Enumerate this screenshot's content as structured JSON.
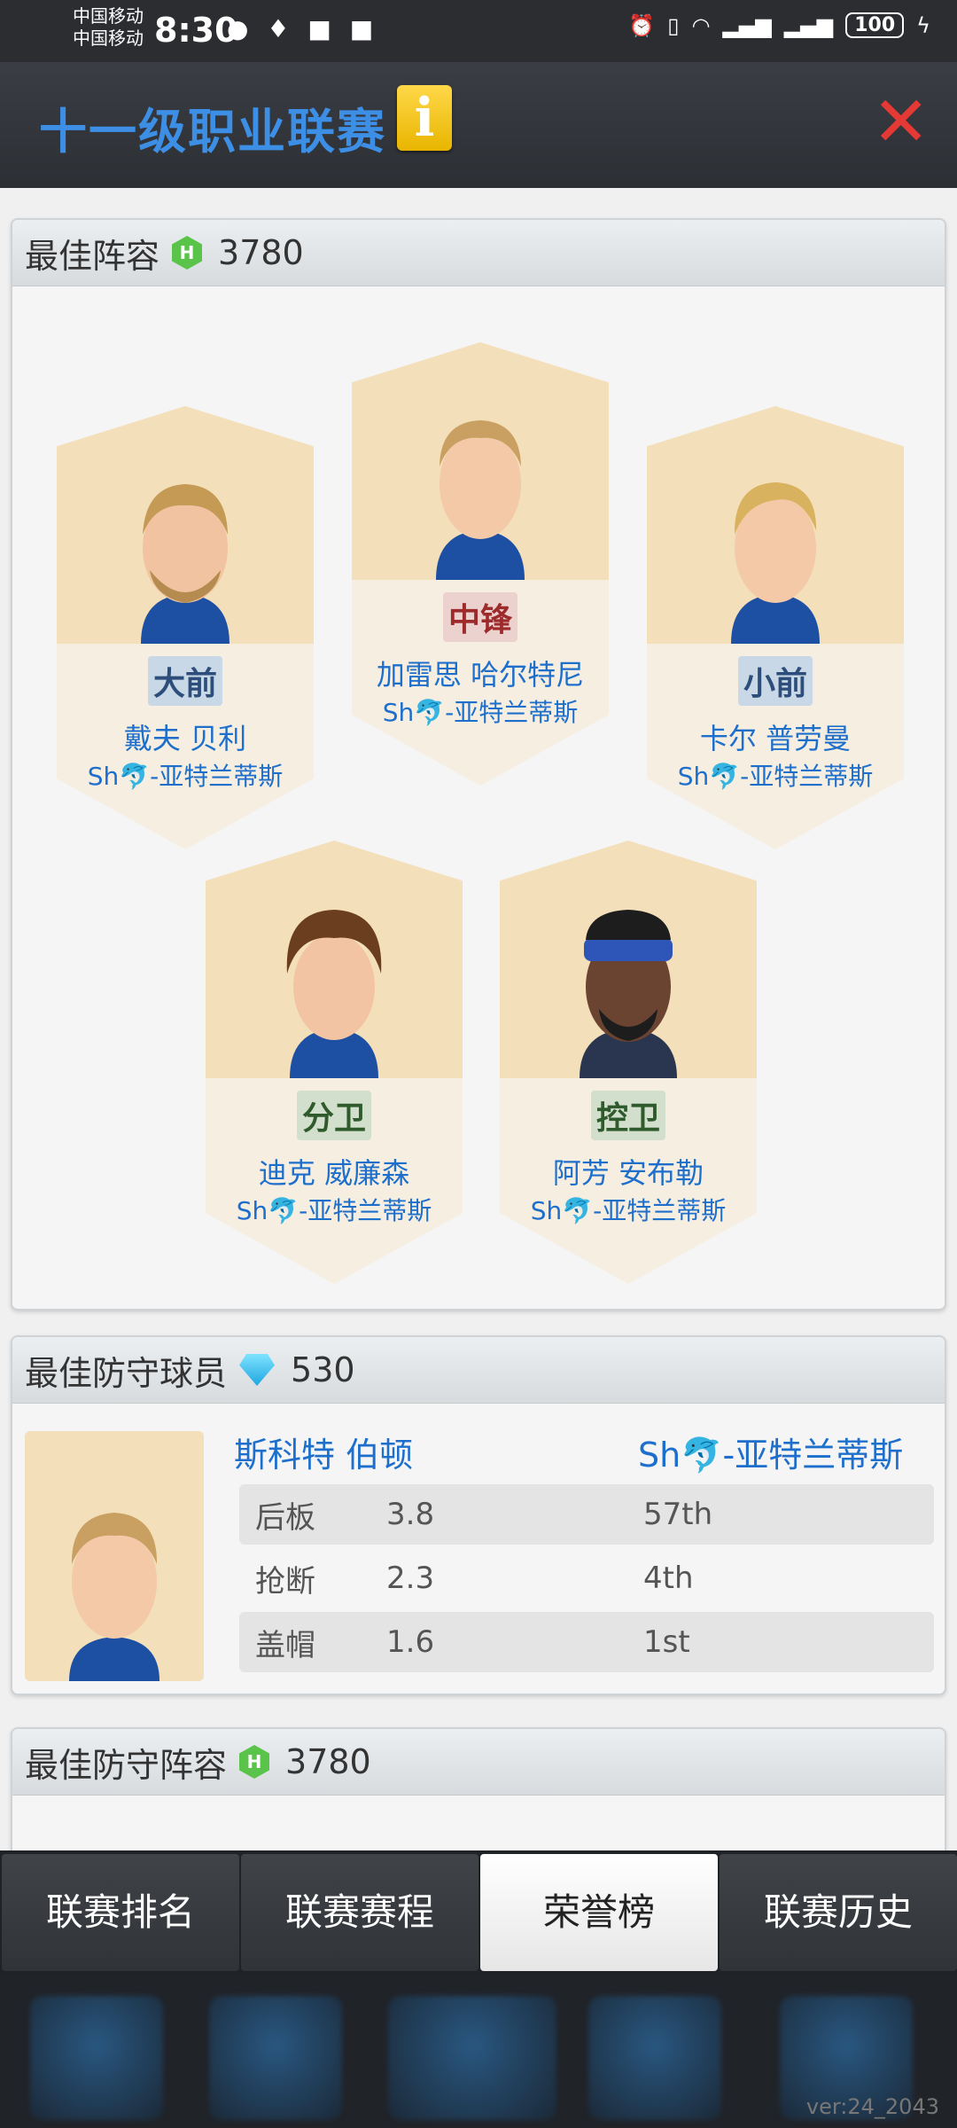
{
  "status_bar": {
    "carrier1": "中国移动",
    "carrier2": "中国移动",
    "time": "8:30",
    "battery": "100"
  },
  "header": {
    "title": "十一级职业联赛",
    "info_label": "i"
  },
  "best_lineup": {
    "title": "最佳阵容",
    "score": "3780",
    "players": [
      {
        "position": "大前",
        "name": "戴夫 贝利",
        "team": "Sh🐬-亚特兰蒂斯",
        "badge_color": "blue"
      },
      {
        "position": "中锋",
        "name": "加雷思 哈尔特尼",
        "team": "Sh🐬-亚特兰蒂斯",
        "badge_color": "red"
      },
      {
        "position": "小前",
        "name": "卡尔 普劳曼",
        "team": "Sh🐬-亚特兰蒂斯",
        "badge_color": "blue"
      },
      {
        "position": "分卫",
        "name": "迪克 威廉森",
        "team": "Sh🐬-亚特兰蒂斯",
        "badge_color": "green"
      },
      {
        "position": "控卫",
        "name": "阿芳 安布勒",
        "team": "Sh🐬-亚特兰蒂斯",
        "badge_color": "green"
      }
    ]
  },
  "best_defender": {
    "title": "最佳防守球员",
    "score": "530",
    "name": "斯科特 伯顿",
    "team": "Sh🐬-亚特兰蒂斯",
    "stats": [
      {
        "label": "后板",
        "value": "3.8",
        "rank": "57th"
      },
      {
        "label": "抢断",
        "value": "2.3",
        "rank": "4th"
      },
      {
        "label": "盖帽",
        "value": "1.6",
        "rank": "1st"
      }
    ]
  },
  "best_defensive_lineup": {
    "title": "最佳防守阵容",
    "score": "3780"
  },
  "tabs": [
    {
      "label": "联赛排名",
      "active": false
    },
    {
      "label": "联赛赛程",
      "active": false
    },
    {
      "label": "荣誉榜",
      "active": true
    },
    {
      "label": "联赛历史",
      "active": false
    }
  ],
  "version": "ver:24_2043",
  "colors": {
    "accent_blue": "#1e6fcc",
    "title_blue": "#3d8fe6",
    "close_red": "#e53935",
    "hex_green": "#59c449"
  }
}
